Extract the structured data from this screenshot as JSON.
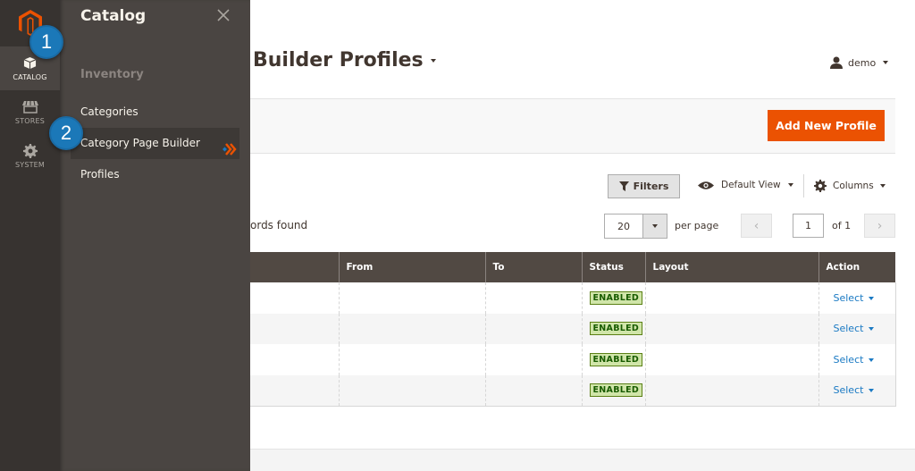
{
  "admin_menu": {
    "logo": "magento-logo",
    "items": [
      {
        "label": "CATALOG",
        "icon": "box-icon",
        "active": true
      },
      {
        "label": "STORES",
        "icon": "storefront-icon",
        "active": false
      },
      {
        "label": "SYSTEM",
        "icon": "gear-icon",
        "active": false
      }
    ]
  },
  "flyout": {
    "title": "Catalog",
    "section": "Inventory",
    "links": [
      "Categories",
      "Category Page Builder Profiles"
    ]
  },
  "callouts": [
    "1",
    "2"
  ],
  "page": {
    "title": "Builder Profiles",
    "user": "demo"
  },
  "actions": {
    "add_button": "Add New Profile"
  },
  "toolbar": {
    "filters": "Filters",
    "view": "Default View",
    "columns": "Columns",
    "records": "ords found",
    "per_page_value": "20",
    "per_page_label": "per page",
    "page_value": "1",
    "page_of": "of 1",
    "prev": "‹",
    "next": "›"
  },
  "grid": {
    "columns": [
      "",
      "From",
      "To",
      "Status",
      "Layout",
      "Action"
    ],
    "rows": [
      {
        "from": "",
        "to": "",
        "status": "ENABLED",
        "layout": "",
        "action": "Select"
      },
      {
        "from": "",
        "to": "",
        "status": "ENABLED",
        "layout": "",
        "action": "Select"
      },
      {
        "from": "",
        "to": "",
        "status": "ENABLED",
        "layout": "",
        "action": "Select"
      },
      {
        "from": "",
        "to": "",
        "status": "ENABLED",
        "layout": "",
        "action": "Select"
      }
    ]
  },
  "colors": {
    "accent": "#eb5202",
    "menu_bg": "#373330",
    "flyout_bg": "#4a4542",
    "header_bg": "#514943",
    "link": "#1979c3",
    "callout": "#1b78b8"
  }
}
